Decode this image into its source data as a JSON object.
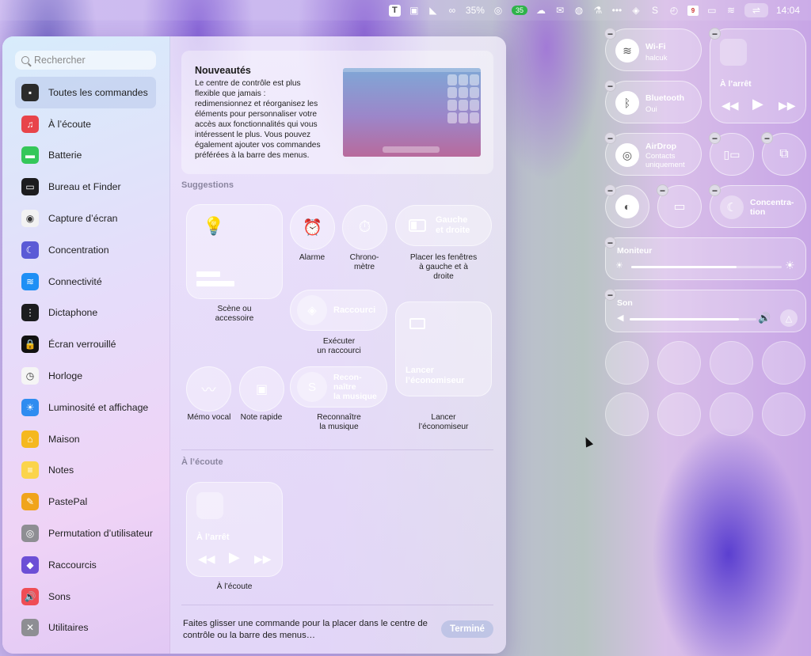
{
  "menubar": {
    "battery_percent": "35%",
    "badge_count": "35",
    "calendar_day": "9",
    "clock": "14:04",
    "t_icon_label": "T",
    "s_icon_label": "S"
  },
  "sidebar": {
    "search_placeholder": "Rechercher",
    "items": [
      {
        "label": "Toutes les commandes",
        "icon": "grid-icon",
        "color": "#2b2b2b",
        "glyph": "▪"
      },
      {
        "label": "À l’écoute",
        "icon": "now-playing-icon",
        "color": "#e8444a",
        "glyph": "♫"
      },
      {
        "label": "Batterie",
        "icon": "battery-icon",
        "color": "#34c759",
        "glyph": "▬"
      },
      {
        "label": "Bureau et Finder",
        "icon": "desktop-icon",
        "color": "#1c1c1e",
        "glyph": "▭"
      },
      {
        "label": "Capture d’écran",
        "icon": "screenshot-icon",
        "color": "#f2f2f2",
        "glyph": "◉"
      },
      {
        "label": "Concentration",
        "icon": "moon-icon",
        "color": "#5b5bd6",
        "glyph": "☾"
      },
      {
        "label": "Connectivité",
        "icon": "wifi-icon",
        "color": "#1f8ff5",
        "glyph": "≋"
      },
      {
        "label": "Dictaphone",
        "icon": "voice-memo-icon",
        "color": "#1c1c1e",
        "glyph": "⋮"
      },
      {
        "label": "Écran verrouillé",
        "icon": "lock-icon",
        "color": "#111111",
        "glyph": "🔒"
      },
      {
        "label": "Horloge",
        "icon": "clock-icon",
        "color": "#f5f5f5",
        "glyph": "◷"
      },
      {
        "label": "Luminosité et affichage",
        "icon": "brightness-icon",
        "color": "#2f8cf0",
        "glyph": "☀"
      },
      {
        "label": "Maison",
        "icon": "home-icon",
        "color": "#f5b81e",
        "glyph": "⌂"
      },
      {
        "label": "Notes",
        "icon": "notes-icon",
        "color": "#fbd44b",
        "glyph": "≡"
      },
      {
        "label": "PastePal",
        "icon": "pastepal-icon",
        "color": "#f0a41c",
        "glyph": "✎"
      },
      {
        "label": "Permutation d’utilisateur",
        "icon": "user-icon",
        "color": "#8e8e93",
        "glyph": "◎"
      },
      {
        "label": "Raccourcis",
        "icon": "shortcuts-icon",
        "color": "#6c4fd6",
        "glyph": "◆"
      },
      {
        "label": "Sons",
        "icon": "speaker-icon",
        "color": "#ef4d55",
        "glyph": "🔊"
      },
      {
        "label": "Utilitaires",
        "icon": "tools-icon",
        "color": "#8e8e93",
        "glyph": "✕"
      }
    ]
  },
  "news": {
    "title": "Nouveautés",
    "body": "Le centre de contrôle est plus flexible que jamais : redimensionnez et réorganisez les éléments pour personnaliser votre accès aux fonctionnalités qui vous intéressent le plus. Vous pouvez également ajouter vos commandes préférées à la barre des menus."
  },
  "suggestions": {
    "title": "Suggestions",
    "scene_label": "Scène ou accessoire",
    "alarm_label": "Alarme",
    "chrono_label": "Chrono-\nmètre",
    "left_right_tile": "Gauche\net droite",
    "left_right_label": "Placer les fenêtres\nà gauche et à\ndroite",
    "shortcut_tile": "Raccourci",
    "shortcut_label": "Exécuter\nun raccourci",
    "voice_memo_label": "Mémo vocal",
    "quick_note_label": "Note rapide",
    "recognize_tile": "Recon-\nnaître\nla musique",
    "recognize_label": "Reconnaître\nla musique",
    "screensaver_tile": "Lancer\nl’économiseur",
    "screensaver_label": "Lancer\nl’économiseur"
  },
  "now_playing": {
    "title": "À l’écoute",
    "status": "À l’arrêt",
    "label": "À l’écoute"
  },
  "footer": {
    "hint": "Faites glisser une commande pour la placer dans le centre de contrôle ou la barre des menus…",
    "done_label": "Terminé"
  },
  "control_center": {
    "wifi_name": "Wi-Fi",
    "wifi_network": "halcuk",
    "bluetooth_name": "Bluetooth",
    "bluetooth_status": "Oui",
    "airdrop_name": "AirDrop",
    "airdrop_status": "Contacts\nuniquement",
    "media_status": "À l’arrêt",
    "focus_name": "Concentra-\ntion",
    "display_name": "Moniteur",
    "display_level": 0.7,
    "sound_name": "Son",
    "sound_level": 0.86
  }
}
